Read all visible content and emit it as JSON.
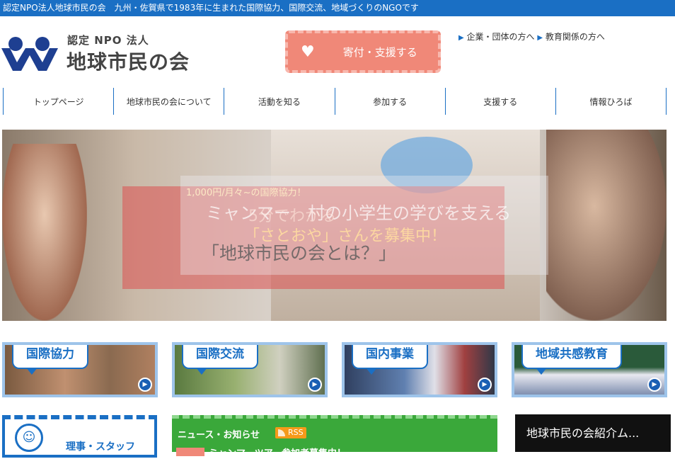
{
  "topbar": {
    "text": "認定NPO法人地球市民の会　九州・佐賀県で1983年に生まれた国際協力、国際交流、地域づくりのNGOです"
  },
  "logo": {
    "sub": "認定 NPO 法人",
    "main": "地球市民の会"
  },
  "donate": {
    "label": "寄付・支援する",
    "icon": "heart-icon"
  },
  "toplinks": [
    {
      "label": "企業・団体の方へ"
    },
    {
      "label": "教育関係の方へ"
    }
  ],
  "nav": [
    {
      "label": "トップページ"
    },
    {
      "label": "地球市民の会について"
    },
    {
      "label": "活動を知る"
    },
    {
      "label": "参加する"
    },
    {
      "label": "支援する"
    },
    {
      "label": "情報ひろば"
    }
  ],
  "hero": {
    "line1": "1,000円/月々~の国際協力！",
    "line2": "ミャンマー　村の小学生の学びを支える",
    "line3": "5分でわかる",
    "line4": "「さとおや」さんを募集中！",
    "line5": "「地球市民の会とは？」"
  },
  "cards": [
    {
      "label": "国際協力"
    },
    {
      "label": "国際交流"
    },
    {
      "label": "国内事業"
    },
    {
      "label": "地域共感教育"
    }
  ],
  "staff": {
    "label": "理事・スタッフ"
  },
  "news": {
    "label": "ニュース・お知らせ",
    "rss": "RSS",
    "first_item": "ミャンマーツアー参加者募集中！"
  },
  "video": {
    "label": "地球市民の会紹介ム..."
  },
  "colors": {
    "brand_blue": "#1a6fc4",
    "donate_coral": "#f08878",
    "news_green": "#3aa83a"
  }
}
